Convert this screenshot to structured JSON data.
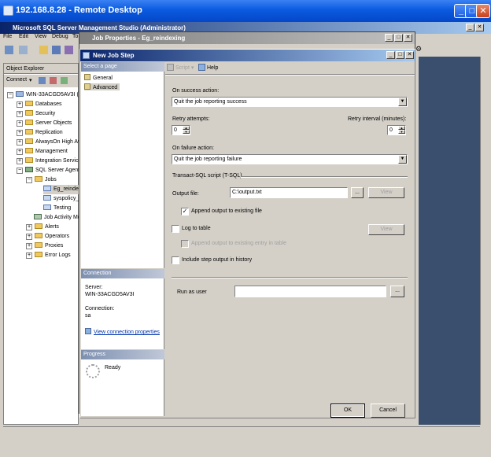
{
  "remote": {
    "title": "192.168.8.28 - Remote Desktop"
  },
  "ssms": {
    "title": "Microsoft SQL Server Management Studio (Administrator)",
    "menu": [
      "File",
      "Edit",
      "View",
      "Debug",
      "To"
    ]
  },
  "object_explorer": {
    "title": "Object Explorer",
    "connect_label": "Connect",
    "tree": {
      "server": "WIN-33ACGD5AV3I (S",
      "databases": "Databases",
      "security": "Security",
      "server_objects": "Server Objects",
      "replication": "Replication",
      "alwayson": "AlwaysOn High Ava",
      "management": "Management",
      "integration": "Integration Service",
      "agent": "SQL Server Agent",
      "jobs": "Jobs",
      "job1": "Eg_reindex",
      "job2": "syspolicy_",
      "job3": "Testing",
      "job_activity": "Job Activity Mo",
      "alerts": "Alerts",
      "operators": "Operators",
      "proxies": "Proxies",
      "error_logs": "Error Logs"
    }
  },
  "job_props": {
    "title": "Job Properties - Eg_reindexing"
  },
  "dialog": {
    "title": "New Job Step",
    "select_page_header": "Select a page",
    "pages": [
      "General",
      "Advanced"
    ],
    "toolbar": {
      "script": "Script",
      "help": "Help"
    },
    "on_success_label": "On success action:",
    "on_success_value": "Quit the job reporting success",
    "retry_attempts_label": "Retry attempts:",
    "retry_attempts_value": "0",
    "retry_interval_label": "Retry interval (minutes):",
    "retry_interval_value": "0",
    "on_failure_label": "On failure action:",
    "on_failure_value": "Quit the job reporting failure",
    "tsql_group": "Transact-SQL script (T-SQL)",
    "output_file_label": "Output file:",
    "output_file_value": "C:\\output.txt",
    "browse_label": "...",
    "view_label": "View",
    "append_output_label": "Append output to existing file",
    "log_to_table_label": "Log to table",
    "view2_label": "View",
    "append_table_label": "Append output to existing entry in table",
    "include_history_label": "Include step output in history",
    "run_as_label": "Run as user",
    "run_as_browse": "...",
    "connection_header": "Connection",
    "server_label": "Server:",
    "server_value": "WIN-33ACGD5AV3I",
    "connection_label": "Connection:",
    "connection_value": "sa",
    "view_conn_props": "View connection properties",
    "progress_header": "Progress",
    "progress_status": "Ready",
    "ok_label": "OK",
    "cancel_label": "Cancel"
  },
  "colors": {
    "xp_title": "#0a5ae0",
    "classic_title": "#0a246a",
    "face": "#d4d0c8",
    "desktop": "#3a4e6e"
  }
}
